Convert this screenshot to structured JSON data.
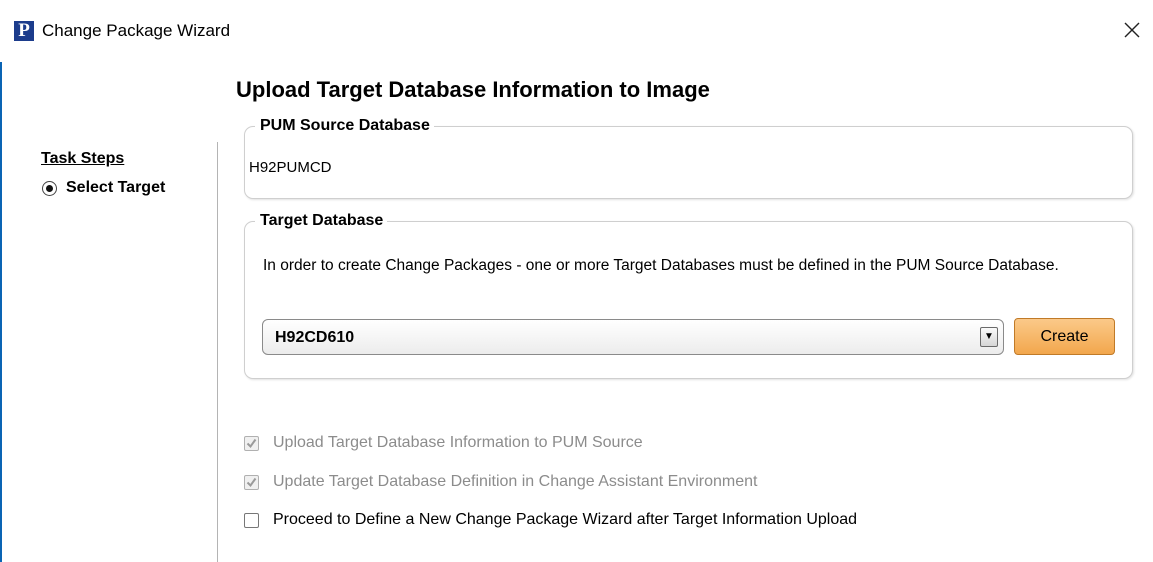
{
  "window": {
    "title": "Change Package Wizard",
    "app_icon_letter": "P",
    "close_glyph": "close-icon"
  },
  "page": {
    "title": "Upload Target Database Information to Image"
  },
  "sidebar": {
    "heading": "Task Steps",
    "steps": [
      {
        "label": "Select Target",
        "selected": true
      }
    ]
  },
  "source_group": {
    "legend": "PUM Source Database",
    "value": "H92PUMCD"
  },
  "target_group": {
    "legend": "Target Database",
    "description": "In order to create Change Packages - one or more Target Databases must be defined in the PUM Source Database.",
    "selected_value": "H92CD610",
    "dropdown_arrow": "▼",
    "create_label": "Create"
  },
  "options": [
    {
      "label": "Upload Target Database Information to PUM Source",
      "checked": true,
      "disabled": true
    },
    {
      "label": "Update Target Database Definition in Change Assistant Environment",
      "checked": true,
      "disabled": true
    },
    {
      "label": "Proceed to Define a New Change Package Wizard after Target Information Upload",
      "checked": false,
      "disabled": false
    }
  ],
  "colors": {
    "accent_blue": "#0a64b4",
    "create_button": "#f6b05e",
    "app_icon_bg": "#1c3c8c",
    "disabled_text": "#8c8c8c"
  }
}
